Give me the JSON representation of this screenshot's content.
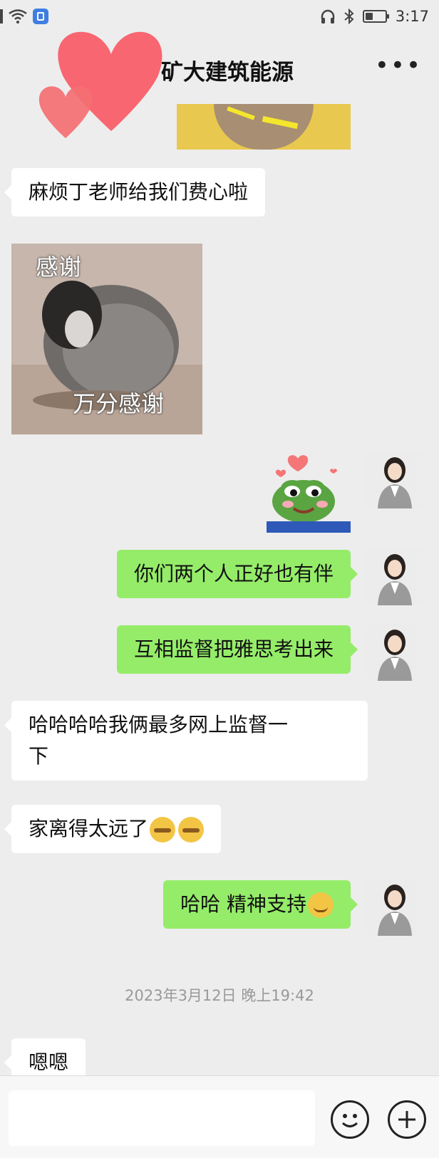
{
  "status_bar": {
    "time": "3:17"
  },
  "header": {
    "title": "矿大建筑能源",
    "more": "•••"
  },
  "stickers": {
    "penguin_top": "感谢",
    "penguin_bottom": "万分感谢"
  },
  "messages": {
    "m1": "麻烦丁老师给我们费心啦",
    "m2": "你们两个人正好也有伴",
    "m3": "互相监督把雅思考出来",
    "m4_line1": "哈哈哈哈我俩最多网上监督一",
    "m4_line2": "下",
    "m5": "家离得太远了",
    "m6": "哈哈 精神支持",
    "m7": "嗯嗯"
  },
  "timestamp": "2023年3月12日 晚上19:42",
  "input_bar": {
    "placeholder": ""
  },
  "colors": {
    "incoming": "#ffffff",
    "outgoing": "#95ec69",
    "background": "#ededed"
  },
  "icons": [
    "wifi-icon",
    "headphones-icon",
    "bluetooth-icon",
    "battery-icon",
    "more-icon",
    "emoji-icon",
    "plus-icon"
  ]
}
